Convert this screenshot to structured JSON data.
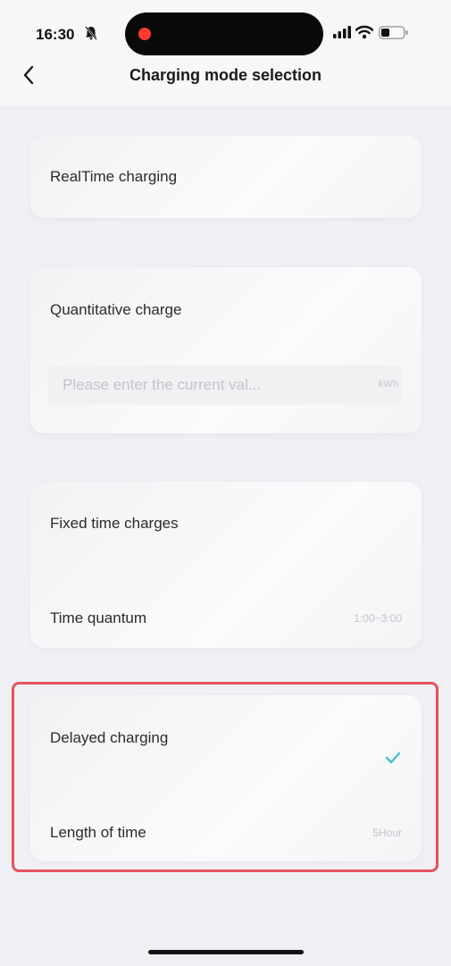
{
  "status_bar": {
    "time": "16:30",
    "icons": [
      "bell-silent-icon",
      "recording-dot-icon",
      "signal-icon",
      "wifi-icon",
      "battery-icon"
    ]
  },
  "header": {
    "title": "Charging mode selection",
    "back_icon": "chevron-left-icon"
  },
  "modes": {
    "realtime": {
      "label": "RealTime charging"
    },
    "quantitative": {
      "label": "Quantitative charge",
      "input_placeholder": "Please enter the current val...",
      "input_value": "",
      "unit": "kWh"
    },
    "fixed_time": {
      "label": "Fixed time charges",
      "time_quantum_label": "Time quantum",
      "time_quantum_value": "1:00~3:00"
    },
    "delayed": {
      "label": "Delayed charging",
      "selected": true,
      "length_label": "Length of time",
      "length_value": "5Hour"
    }
  },
  "colors": {
    "accent_check": "#4cbcc8",
    "highlight_border": "#e8525f",
    "background": "#eef0f3"
  }
}
